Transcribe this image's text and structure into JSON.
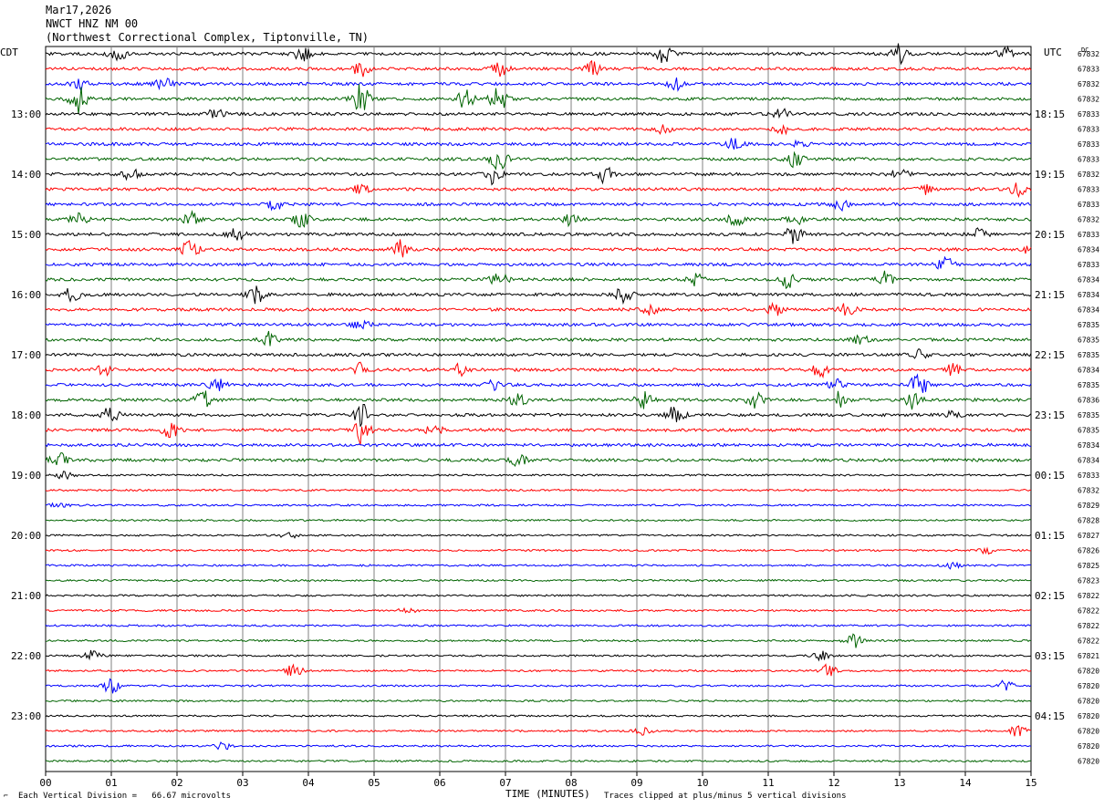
{
  "header": {
    "date": "Mar17,2026",
    "station": "NWCT HNZ NM 00",
    "location": "(Northwest Correctional Complex, Tiptonville, TN)"
  },
  "left_timezone": "CDT",
  "right_timezone": "UTC",
  "dc_label": "DC",
  "footer": {
    "scale_note": "Each Vertical Division =   66.67 microvolts",
    "xlabel": "TIME (MINUTES)",
    "clip_note": "Traces clipped at plus/minus 5 vertical divisions"
  },
  "colors": {
    "cycle": [
      "#000000",
      "#ff0000",
      "#0000ff",
      "#006400"
    ],
    "grid": "#808080"
  },
  "chart_data": {
    "type": "line",
    "xlabel": "TIME (MINUTES)",
    "xlim": [
      0,
      15
    ],
    "x_ticks": [
      "00",
      "01",
      "02",
      "03",
      "04",
      "05",
      "06",
      "07",
      "08",
      "09",
      "10",
      "11",
      "12",
      "13",
      "14",
      "15"
    ],
    "left_hour_labels": [
      "13:00",
      "14:00",
      "15:00",
      "16:00",
      "17:00",
      "18:00",
      "19:00",
      "20:00",
      "21:00",
      "22:00",
      "23:00"
    ],
    "right_hour_labels": [
      "18:15",
      "19:15",
      "20:15",
      "21:15",
      "22:15",
      "23:15",
      "00:15",
      "01:15",
      "02:15",
      "03:15",
      "04:15"
    ],
    "trace_count": 48,
    "dc_offsets": [
      "67832",
      "67833",
      "67832",
      "67832",
      "67833",
      "67833",
      "67833",
      "67833",
      "67832",
      "67833",
      "67833",
      "67832",
      "67833",
      "67834",
      "67833",
      "67834",
      "67834",
      "67834",
      "67835",
      "67835",
      "67835",
      "67834",
      "67835",
      "67836",
      "67835",
      "67835",
      "67834",
      "67834",
      "67833",
      "67832",
      "67829",
      "67828",
      "67827",
      "67826",
      "67825",
      "67823",
      "67822",
      "67822",
      "67822",
      "67822",
      "67821",
      "67820",
      "67820",
      "67820",
      "67820",
      "67820",
      "67820",
      "67820"
    ],
    "events": [
      {
        "trace": 0,
        "minute": 1.1,
        "amp": 9
      },
      {
        "trace": 0,
        "minute": 3.9,
        "amp": 8
      },
      {
        "trace": 0,
        "minute": 9.4,
        "amp": 10
      },
      {
        "trace": 0,
        "minute": 13.0,
        "amp": 11
      },
      {
        "trace": 0,
        "minute": 14.6,
        "amp": 7
      },
      {
        "trace": 1,
        "minute": 4.8,
        "amp": 8
      },
      {
        "trace": 1,
        "minute": 6.9,
        "amp": 10
      },
      {
        "trace": 1,
        "minute": 8.3,
        "amp": 9
      },
      {
        "trace": 2,
        "minute": 0.5,
        "amp": 7
      },
      {
        "trace": 2,
        "minute": 1.8,
        "amp": 7
      },
      {
        "trace": 2,
        "minute": 9.6,
        "amp": 6
      },
      {
        "trace": 3,
        "minute": 0.5,
        "amp": 16
      },
      {
        "trace": 3,
        "minute": 4.8,
        "amp": 16
      },
      {
        "trace": 3,
        "minute": 6.4,
        "amp": 11
      },
      {
        "trace": 3,
        "minute": 6.9,
        "amp": 15
      },
      {
        "trace": 4,
        "minute": 2.6,
        "amp": 6
      },
      {
        "trace": 4,
        "minute": 11.2,
        "amp": 5
      },
      {
        "trace": 5,
        "minute": 9.4,
        "amp": 6
      },
      {
        "trace": 5,
        "minute": 11.2,
        "amp": 5
      },
      {
        "trace": 6,
        "minute": 10.5,
        "amp": 8
      },
      {
        "trace": 6,
        "minute": 11.5,
        "amp": 5
      },
      {
        "trace": 7,
        "minute": 6.9,
        "amp": 14
      },
      {
        "trace": 7,
        "minute": 11.4,
        "amp": 8
      },
      {
        "trace": 8,
        "minute": 1.3,
        "amp": 6
      },
      {
        "trace": 8,
        "minute": 6.8,
        "amp": 10
      },
      {
        "trace": 8,
        "minute": 8.5,
        "amp": 9
      },
      {
        "trace": 8,
        "minute": 13.0,
        "amp": 7
      },
      {
        "trace": 9,
        "minute": 4.8,
        "amp": 6
      },
      {
        "trace": 9,
        "minute": 13.4,
        "amp": 6
      },
      {
        "trace": 9,
        "minute": 14.8,
        "amp": 7
      },
      {
        "trace": 10,
        "minute": 3.5,
        "amp": 6
      },
      {
        "trace": 10,
        "minute": 12.1,
        "amp": 6
      },
      {
        "trace": 11,
        "minute": 0.5,
        "amp": 7
      },
      {
        "trace": 11,
        "minute": 2.2,
        "amp": 8
      },
      {
        "trace": 11,
        "minute": 3.9,
        "amp": 9
      },
      {
        "trace": 11,
        "minute": 8.0,
        "amp": 7
      },
      {
        "trace": 11,
        "minute": 10.5,
        "amp": 9
      },
      {
        "trace": 11,
        "minute": 11.4,
        "amp": 7
      },
      {
        "trace": 12,
        "minute": 2.9,
        "amp": 7
      },
      {
        "trace": 12,
        "minute": 11.4,
        "amp": 11
      },
      {
        "trace": 12,
        "minute": 14.2,
        "amp": 6
      },
      {
        "trace": 13,
        "minute": 2.2,
        "amp": 10
      },
      {
        "trace": 13,
        "minute": 5.4,
        "amp": 10
      },
      {
        "trace": 13,
        "minute": 15.0,
        "amp": 8
      },
      {
        "trace": 14,
        "minute": 13.7,
        "amp": 8
      },
      {
        "trace": 15,
        "minute": 6.9,
        "amp": 8
      },
      {
        "trace": 15,
        "minute": 9.9,
        "amp": 9
      },
      {
        "trace": 15,
        "minute": 11.3,
        "amp": 9
      },
      {
        "trace": 15,
        "minute": 12.8,
        "amp": 9
      },
      {
        "trace": 16,
        "minute": 0.4,
        "amp": 9
      },
      {
        "trace": 16,
        "minute": 3.2,
        "amp": 9
      },
      {
        "trace": 16,
        "minute": 8.8,
        "amp": 8
      },
      {
        "trace": 17,
        "minute": 9.2,
        "amp": 5
      },
      {
        "trace": 17,
        "minute": 11.1,
        "amp": 6
      },
      {
        "trace": 17,
        "minute": 12.2,
        "amp": 7
      },
      {
        "trace": 18,
        "minute": 4.8,
        "amp": 5
      },
      {
        "trace": 19,
        "minute": 3.4,
        "amp": 8
      },
      {
        "trace": 19,
        "minute": 12.4,
        "amp": 5
      },
      {
        "trace": 20,
        "minute": 13.3,
        "amp": 5
      },
      {
        "trace": 21,
        "minute": 0.9,
        "amp": 5
      },
      {
        "trace": 21,
        "minute": 4.8,
        "amp": 8
      },
      {
        "trace": 21,
        "minute": 6.3,
        "amp": 7
      },
      {
        "trace": 21,
        "minute": 11.8,
        "amp": 8
      },
      {
        "trace": 21,
        "minute": 13.8,
        "amp": 6
      },
      {
        "trace": 22,
        "minute": 2.6,
        "amp": 8
      },
      {
        "trace": 22,
        "minute": 6.8,
        "amp": 6
      },
      {
        "trace": 22,
        "minute": 12.0,
        "amp": 7
      },
      {
        "trace": 22,
        "minute": 13.3,
        "amp": 16
      },
      {
        "trace": 23,
        "minute": 2.4,
        "amp": 11
      },
      {
        "trace": 23,
        "minute": 7.2,
        "amp": 8
      },
      {
        "trace": 23,
        "minute": 9.1,
        "amp": 10
      },
      {
        "trace": 23,
        "minute": 10.8,
        "amp": 11
      },
      {
        "trace": 23,
        "minute": 12.1,
        "amp": 9
      },
      {
        "trace": 23,
        "minute": 13.2,
        "amp": 10
      },
      {
        "trace": 24,
        "minute": 1.0,
        "amp": 10
      },
      {
        "trace": 24,
        "minute": 4.8,
        "amp": 13
      },
      {
        "trace": 24,
        "minute": 9.6,
        "amp": 11
      },
      {
        "trace": 24,
        "minute": 13.8,
        "amp": 6
      },
      {
        "trace": 25,
        "minute": 1.9,
        "amp": 8
      },
      {
        "trace": 25,
        "minute": 4.8,
        "amp": 16
      },
      {
        "trace": 25,
        "minute": 5.9,
        "amp": 8
      },
      {
        "trace": 27,
        "minute": 0.2,
        "amp": 8
      },
      {
        "trace": 27,
        "minute": 7.2,
        "amp": 7
      },
      {
        "trace": 28,
        "minute": 0.3,
        "amp": 5
      },
      {
        "trace": 30,
        "minute": 0.2,
        "amp": 3
      },
      {
        "trace": 32,
        "minute": 3.7,
        "amp": 4
      },
      {
        "trace": 33,
        "minute": 14.3,
        "amp": 4
      },
      {
        "trace": 34,
        "minute": 13.8,
        "amp": 3
      },
      {
        "trace": 37,
        "minute": 5.5,
        "amp": 3
      },
      {
        "trace": 39,
        "minute": 12.3,
        "amp": 8
      },
      {
        "trace": 40,
        "minute": 0.7,
        "amp": 8
      },
      {
        "trace": 40,
        "minute": 11.8,
        "amp": 5
      },
      {
        "trace": 41,
        "minute": 3.8,
        "amp": 10
      },
      {
        "trace": 41,
        "minute": 11.9,
        "amp": 7
      },
      {
        "trace": 42,
        "minute": 1.0,
        "amp": 8
      },
      {
        "trace": 42,
        "minute": 14.6,
        "amp": 6
      },
      {
        "trace": 45,
        "minute": 9.1,
        "amp": 5
      },
      {
        "trace": 45,
        "minute": 14.8,
        "amp": 6
      },
      {
        "trace": 46,
        "minute": 2.7,
        "amp": 4
      }
    ]
  }
}
